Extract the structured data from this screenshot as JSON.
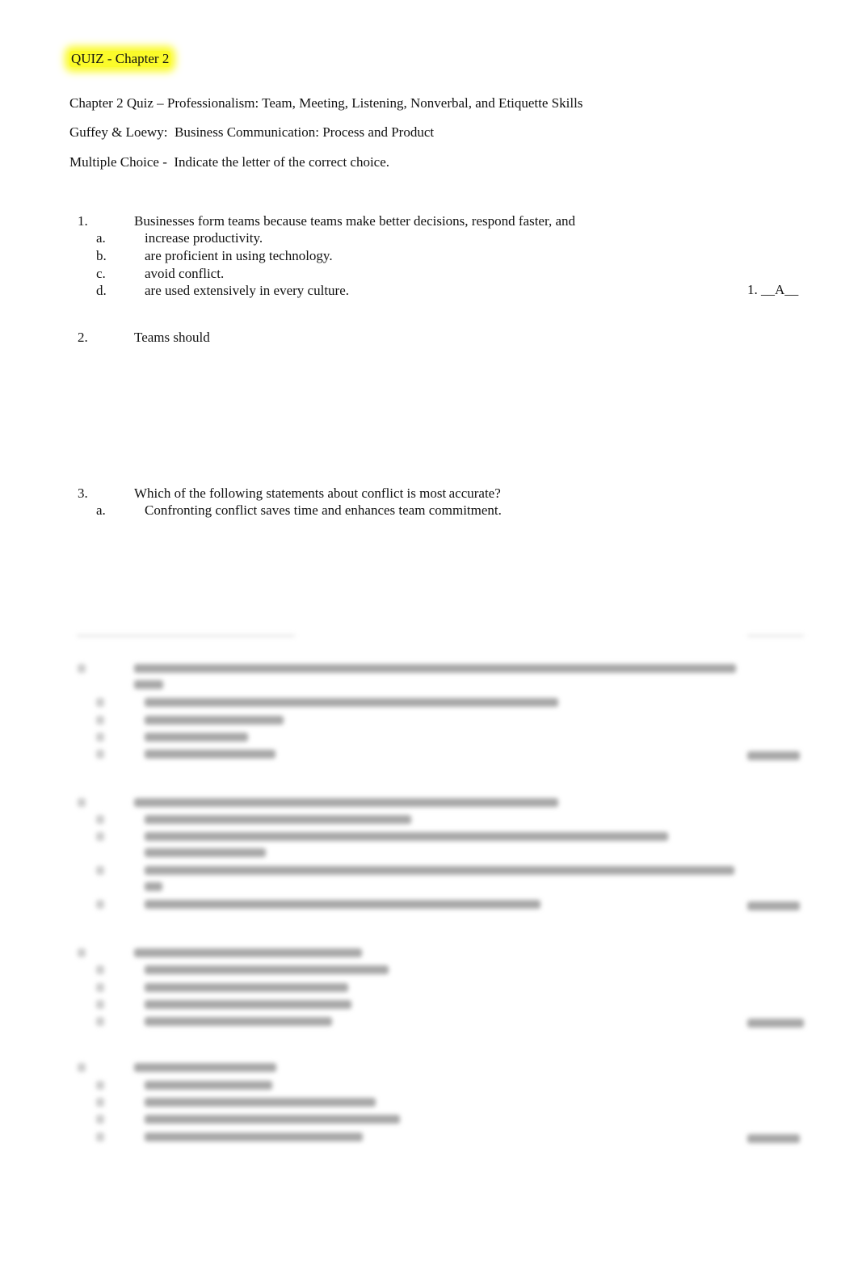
{
  "document": {
    "title": "QUIZ  - Chapter 2",
    "highlight_color": "#fbfb2a",
    "header_lines": [
      "Chapter 2 Quiz – Professionalism: Team, Meeting, Listening, Nonverbal, and Etiquette Skills",
      "Guffey & Loewy: Business Communication:  Process and Product",
      "Multiple Choice - Indicate the letter of the correct choice."
    ]
  },
  "questions": [
    {
      "number": "1.",
      "text": "Businesses form teams because teams make better decisions, respond faster, and",
      "options": [
        {
          "letter": "a.",
          "text": "increase productivity."
        },
        {
          "letter": "b.",
          "text": "are proficient in using technology."
        },
        {
          "letter": "c.",
          "text": "avoid conflict."
        },
        {
          "letter": "d.",
          "text": "are used extensively in every culture."
        }
      ],
      "answer": "1. __A__"
    },
    {
      "number": "2.",
      "text": "Teams should",
      "options": []
    },
    {
      "number": "3.",
      "text": "Which of the following statements about conflict is most accurate?",
      "options": [
        {
          "letter": "a.",
          "text": "Confronting conflict saves time and enhances team commitment."
        }
      ]
    }
  ],
  "obscured_section": {
    "note": "blurred content (questions 4–7), not legible"
  }
}
